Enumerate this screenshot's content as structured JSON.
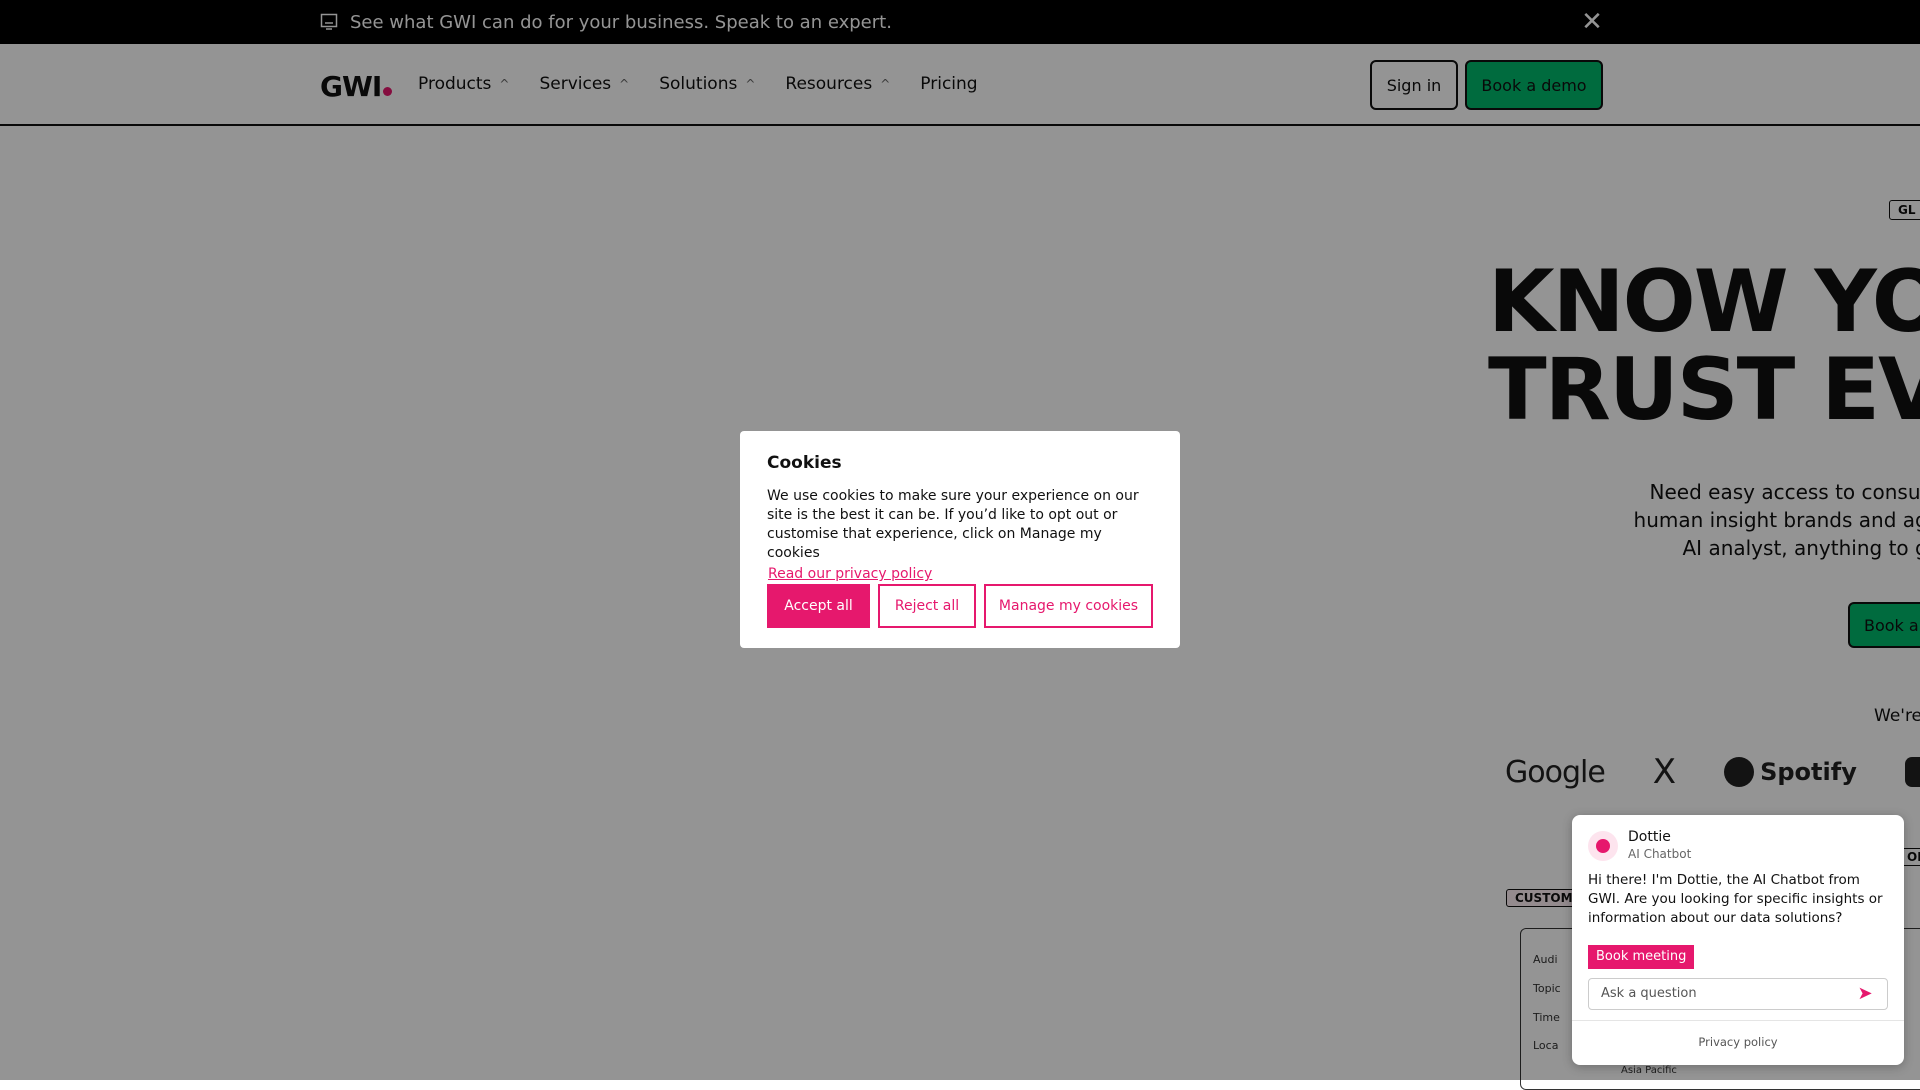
{
  "banner": {
    "message": "See what GWI can do for your business. Speak to an expert.",
    "close_icon": "close-icon"
  },
  "nav": {
    "logo": "GWI",
    "items": [
      {
        "label": "Products",
        "has_chevron": true
      },
      {
        "label": "Services",
        "has_chevron": true
      },
      {
        "label": "Solutions",
        "has_chevron": true
      },
      {
        "label": "Resources",
        "has_chevron": true
      },
      {
        "label": "Pricing",
        "has_chevron": false
      }
    ],
    "signin": "Sign in",
    "book_demo": "Book a demo"
  },
  "hero": {
    "tag": "GL",
    "title_line1": "KNOW YOU",
    "title_line2": "TRUST EVE",
    "subtitle_line1": "Need easy access to consum",
    "subtitle_line2": "human insight brands and age",
    "subtitle_line3": "AI analyst, anything to ge",
    "book_label": "Book a",
    "trusted": "We're",
    "logos": [
      "Google",
      "X",
      "Spotify",
      "Snapchat"
    ],
    "customer_tag": "CUSTOM",
    "right_tag": "ON",
    "mock_rows": [
      "Audi",
      "Topic",
      "Time",
      "Loca"
    ],
    "mock_region": "Asia Pacific"
  },
  "cookie": {
    "title": "Cookies",
    "body": "We use cookies to make sure your experience on our site is the best it can be. If you’d like to opt out or customise that experience, click on Manage my cookies",
    "privacy_link": "Read our privacy policy",
    "accept": "Accept all",
    "reject": "Reject all",
    "manage": "Manage my cookies"
  },
  "chat": {
    "name": "Dottie",
    "role": "AI Chatbot",
    "message": "Hi there! I'm Dottie, the AI Chatbot from GWI. Are you looking for specific insights or information about our data solutions?",
    "book_meeting": "Book meeting",
    "placeholder": "Ask a question",
    "privacy": "Privacy policy"
  },
  "colors": {
    "accent": "#e6186d",
    "green": "#00b86b",
    "overlay": "rgba(0,0,0,0.42)"
  }
}
